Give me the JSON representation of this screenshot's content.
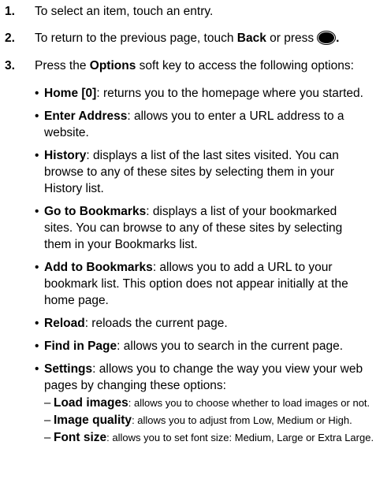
{
  "steps": [
    {
      "num": "1.",
      "text": "To select an item, touch an entry."
    },
    {
      "num": "2.",
      "pre": "To return to the previous page, touch ",
      "bold": "Back",
      "post": " or press",
      "end": "."
    },
    {
      "num": "3.",
      "pre": "Press the ",
      "bold": "Options",
      "post": " soft key to access the following options:"
    }
  ],
  "options": [
    {
      "term": "Home [0]",
      "desc": ": returns you to the homepage where you started."
    },
    {
      "term": "Enter Address",
      "desc": ": allows you to enter a URL address to a website."
    },
    {
      "term": "History",
      "desc": ": displays a list of the last sites visited. You can browse to any of these sites by selecting them in your History list."
    },
    {
      "term": "Go to Bookmarks",
      "desc": ": displays a list of your bookmarked sites. You can browse to any of these sites by selecting them in your Bookmarks list."
    },
    {
      "term": "Add to Bookmarks",
      "desc": ": allows you to add a URL to your bookmark list. This option does not appear initially at the home page."
    },
    {
      "term": "Reload",
      "desc": ": reloads the current page."
    },
    {
      "term": "Find in Page",
      "desc": ": allows you to search in the current page."
    },
    {
      "term": "Settings",
      "desc": ": allows you to change the way you view your web pages by changing these options:"
    }
  ],
  "settings_options": [
    {
      "term": "Load images",
      "desc": ": allows you to choose whether to load images or not."
    },
    {
      "term": "Image quality",
      "desc": ": allows you to adjust from Low, Medium or High."
    },
    {
      "term": "Font size",
      "desc": ": allows you to set font size: Medium, Large or Extra Large."
    }
  ],
  "icons": {
    "end_key": "end-key-icon"
  }
}
